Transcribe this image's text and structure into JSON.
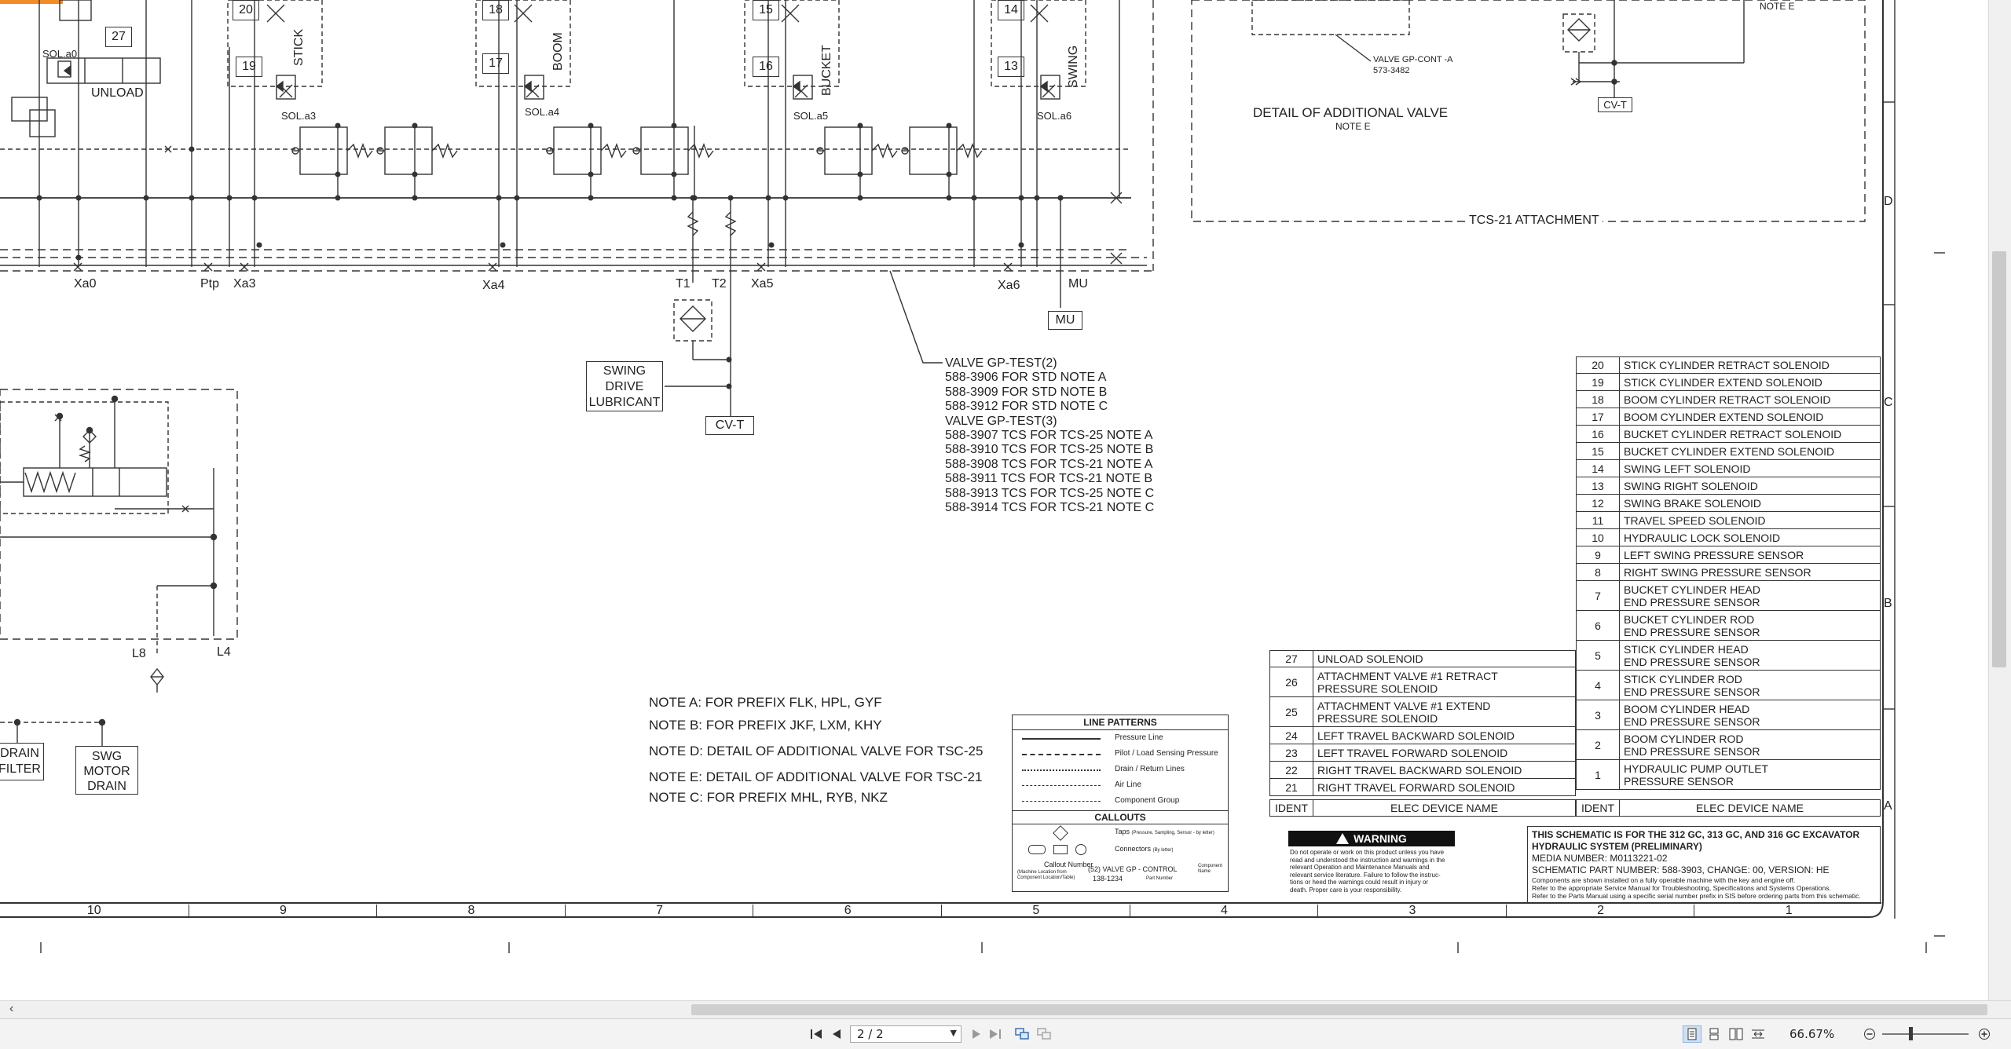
{
  "drawing": {
    "valve_numbers": [
      "27",
      "20",
      "19",
      "18",
      "17",
      "15",
      "16",
      "14",
      "13"
    ],
    "function_labels": [
      "STICK",
      "BOOM",
      "BUCKET",
      "SWING"
    ],
    "unload_label": "UNLOAD",
    "solenoid_labels": [
      "SOL.a0",
      "SOL.a3",
      "SOL.a4",
      "SOL.a5",
      "SOL.a6"
    ],
    "port_labels": [
      "Xa0",
      "Ptp",
      "Xa3",
      "Xa4",
      "T1",
      "T2",
      "Xa5",
      "Xa6",
      "MU"
    ],
    "mu_box": "MU",
    "swing_drive_lubricant": [
      "SWING",
      "DRIVE",
      "LUBRICANT"
    ],
    "cvt_box": "CV-T",
    "cvt_box_2": "CV-T",
    "l8": "L8",
    "l4": "L4",
    "drain_filter": [
      "DRAIN",
      "FILTER"
    ],
    "swg_motor_drain": [
      "SWG",
      "MOTOR",
      "DRAIN"
    ],
    "note_e_top": "NOTE E",
    "valve_gp_cont_a": "VALVE GP-CONT -A",
    "part_573_3482": "573-3482",
    "detail_additional_valve": "DETAIL OF ADDITIONAL VALVE",
    "detail_note_e": "NOTE E",
    "tcs21_attachment": "TCS-21 ATTACHMENT",
    "zone_letters": [
      "D",
      "C",
      "B",
      "A"
    ],
    "valve_callout_lines": [
      "VALVE GP-TEST(2)",
      "588-3906 FOR STD NOTE A",
      "588-3909 FOR STD NOTE B",
      "588-3912 FOR STD NOTE C",
      "VALVE GP-TEST(3)",
      "588-3907 TCS FOR TCS-25 NOTE A",
      "588-3910 TCS FOR TCS-25 NOTE B",
      "588-3908 TCS FOR TCS-21 NOTE A",
      "588-3911 TCS FOR TCS-21 NOTE B",
      "588-3913 TCS FOR TCS-25 NOTE C",
      "588-3914 TCS FOR TCS-21 NOTE C"
    ],
    "notes": [
      "NOTE A: FOR PREFIX FLK, HPL, GYF",
      "NOTE B: FOR PREFIX JKF, LXM, KHY",
      "NOTE D: DETAIL OF ADDITIONAL VALVE FOR TSC-25",
      "NOTE E: DETAIL OF ADDITIONAL VALVE FOR TSC-21",
      "NOTE C: FOR PREFIX MHL, RYB, NKZ"
    ],
    "legend": {
      "title": "LINE PATTERNS",
      "patterns": [
        "Pressure Line",
        "Pilot / Load Sensing Pressure",
        "Drain / Return Lines",
        "Air Line",
        "Component Group"
      ],
      "callouts_title": "CALLOUTS",
      "taps": "Taps",
      "taps_note": "(Pressure, Sampling, Sensor - by letter)",
      "connectors": "Connectors",
      "connectors_note": "(By letter)",
      "callout_number": "Callout Number",
      "callout_sub": "(Machine Location from Component Location/Table)",
      "callout_example": "(52) VALVE GP - CONTROL",
      "callout_part": "138-1234",
      "component_name": "Component Name",
      "part_number": "Part Number"
    },
    "device_table_right": [
      {
        "id": "20",
        "name": [
          "STICK CYLINDER RETRACT SOLENOID"
        ]
      },
      {
        "id": "19",
        "name": [
          "STICK CYLINDER EXTEND SOLENOID"
        ]
      },
      {
        "id": "18",
        "name": [
          "BOOM CYLINDER RETRACT SOLENOID"
        ]
      },
      {
        "id": "17",
        "name": [
          "BOOM CYLINDER EXTEND SOLENOID"
        ]
      },
      {
        "id": "16",
        "name": [
          "BUCKET CYLINDER RETRACT SOLENOID"
        ]
      },
      {
        "id": "15",
        "name": [
          "BUCKET CYLINDER EXTEND SOLENOID"
        ]
      },
      {
        "id": "14",
        "name": [
          "SWING LEFT SOLENOID"
        ]
      },
      {
        "id": "13",
        "name": [
          "SWING RIGHT SOLENOID"
        ]
      },
      {
        "id": "12",
        "name": [
          "SWING BRAKE SOLENOID"
        ]
      },
      {
        "id": "11",
        "name": [
          "TRAVEL SPEED SOLENOID"
        ]
      },
      {
        "id": "10",
        "name": [
          "HYDRAULIC LOCK SOLENOID"
        ]
      },
      {
        "id": "9",
        "name": [
          "LEFT SWING PRESSURE SENSOR"
        ]
      },
      {
        "id": "8",
        "name": [
          "RIGHT SWING PRESSURE SENSOR"
        ]
      },
      {
        "id": "7",
        "name": [
          "BUCKET CYLINDER HEAD",
          "END PRESSURE SENSOR"
        ]
      },
      {
        "id": "6",
        "name": [
          "BUCKET CYLINDER ROD",
          "END PRESSURE SENSOR"
        ]
      },
      {
        "id": "5",
        "name": [
          "STICK CYLINDER HEAD",
          "END PRESSURE SENSOR"
        ]
      },
      {
        "id": "4",
        "name": [
          "STICK CYLINDER ROD",
          "END PRESSURE SENSOR"
        ]
      },
      {
        "id": "3",
        "name": [
          "BOOM CYLINDER HEAD",
          "END PRESSURE SENSOR"
        ]
      },
      {
        "id": "2",
        "name": [
          "BOOM CYLINDER ROD",
          "END PRESSURE SENSOR"
        ]
      },
      {
        "id": "1",
        "name": [
          "HYDRAULIC PUMP OUTLET",
          "PRESSURE SENSOR"
        ]
      }
    ],
    "device_table_left": [
      {
        "id": "27",
        "name": [
          "UNLOAD SOLENOID"
        ]
      },
      {
        "id": "26",
        "name": [
          "ATTACHMENT VALVE #1 RETRACT",
          "PRESSURE SOLENOID"
        ]
      },
      {
        "id": "25",
        "name": [
          "ATTACHMENT VALVE #1 EXTEND",
          "PRESSURE SOLENOID"
        ]
      },
      {
        "id": "24",
        "name": [
          "LEFT TRAVEL BACKWARD SOLENOID"
        ]
      },
      {
        "id": "23",
        "name": [
          "LEFT TRAVEL FORWARD SOLENOID"
        ]
      },
      {
        "id": "22",
        "name": [
          "RIGHT TRAVEL BACKWARD SOLENOID"
        ]
      },
      {
        "id": "21",
        "name": [
          "RIGHT TRAVEL FORWARD SOLENOID"
        ]
      }
    ],
    "table_header_ident": "IDENT",
    "table_header_name": "ELEC DEVICE NAME",
    "warning_title": "WARNING",
    "warning_lines": [
      "Do not operate or work on this product unless you have",
      "read and understood the instruction and warnings in the",
      "relevant Operation and Maintenance Manuals and",
      "relevant service literature. Failure to follow the instruc-",
      "tions or heed the warnings could result in injury or",
      "death. Proper care is your responsibility."
    ],
    "title_block": [
      "THIS SCHEMATIC IS FOR THE 312 GC, 313 GC, AND 316 GC EXCAVATOR",
      "HYDRAULIC SYSTEM (PRELIMINARY)",
      "MEDIA NUMBER: M0113221-02",
      "SCHEMATIC PART NUMBER: 588-3903, CHANGE: 00, VERSION: HE",
      "Components are shown installed on a fully operable machine with the key and engine off.",
      "Refer to the appropriate Service Manual for Troubleshooting, Specifications and Systems Operations.",
      "Refer to the Parts Manual using a specific serial number prefix in SIS before ordering parts from this schematic."
    ],
    "grid_numbers": [
      "10",
      "9",
      "8",
      "7",
      "6",
      "5",
      "4",
      "3",
      "2",
      "1"
    ]
  },
  "toolbar": {
    "page_value": "2 / 2",
    "zoom_value": "66.67%"
  },
  "colors": {
    "accent_orange": "#f28c28",
    "line": "#333333"
  }
}
